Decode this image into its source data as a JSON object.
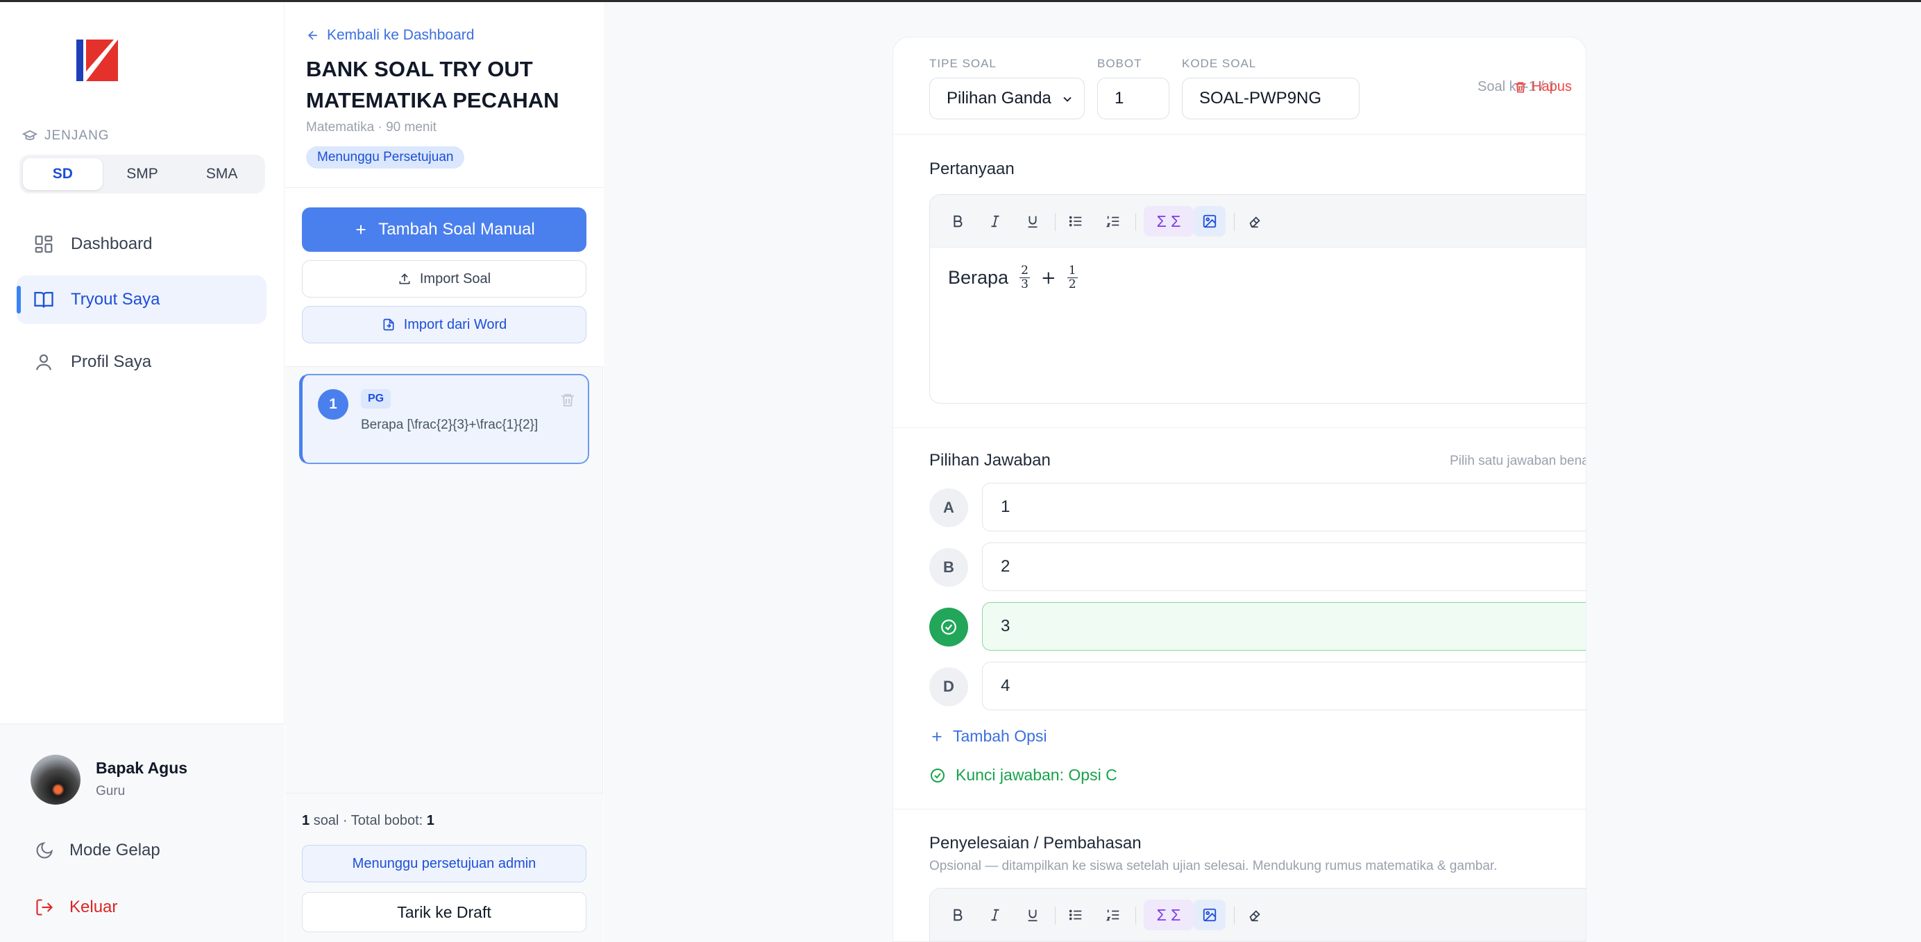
{
  "sidebar": {
    "jenjang_label": "JENJANG",
    "levels": [
      "SD",
      "SMP",
      "SMA"
    ],
    "nav": [
      {
        "label": "Dashboard",
        "icon": "grid-icon"
      },
      {
        "label": "Tryout Saya",
        "icon": "book-icon"
      },
      {
        "label": "Profil Saya",
        "icon": "user-icon"
      }
    ],
    "user": {
      "name": "Bapak Agus",
      "role": "Guru"
    },
    "dark_mode_label": "Mode Gelap",
    "logout_label": "Keluar"
  },
  "panel": {
    "back_label": "Kembali ke Dashboard",
    "title": "BANK SOAL TRY OUT MATEMATIKA PECAHAN",
    "subtitle": "Matematika · 90 menit",
    "status_badge": "Menunggu Persetujuan",
    "add_manual_label": "Tambah Soal Manual",
    "import_label": "Import Soal",
    "import_word_label": "Import dari Word",
    "question_item": {
      "number": "1",
      "tag": "PG",
      "text": "Berapa [\\frac{2}{3}+\\frac{1}{2}]"
    },
    "footer": {
      "count": "1",
      "count_suffix": "soal · Total bobot:",
      "total": "1"
    },
    "waiting_label": "Menunggu persetujuan admin",
    "draft_label": "Tarik ke Draft"
  },
  "editor": {
    "tipe_label": "TIPE SOAL",
    "tipe_value": "Pilihan Ganda",
    "bobot_label": "BOBOT",
    "bobot_value": "1",
    "kode_label": "KODE SOAL",
    "kode_value": "SOAL-PWP9NG",
    "soal_ke": "Soal ke-1 / 1",
    "hapus_label": "Hapus",
    "pertanyaan_label": "Pertanyaan",
    "question_prefix": "Berapa",
    "fraction1": {
      "num": "2",
      "den": "3"
    },
    "operator": "+",
    "fraction2": {
      "num": "1",
      "den": "2"
    },
    "sigma_label": "Σ Σ",
    "pilihan_label": "Pilihan Jawaban",
    "pilihan_hint": "Pilih satu jawaban benar",
    "options": [
      {
        "letter": "A",
        "value": "1"
      },
      {
        "letter": "B",
        "value": "2"
      },
      {
        "letter": "C",
        "value": "3"
      },
      {
        "letter": "D",
        "value": "4"
      }
    ],
    "add_option_label": "Tambah Opsi",
    "kunci_label": "Kunci jawaban: Opsi C",
    "pembahasan_label": "Penyelesaian / Pembahasan",
    "pembahasan_desc": "Opsional — ditampilkan ke siswa setelah ujian selesai. Mendukung rumus matematika & gambar."
  },
  "colors": {
    "accent": "#4a7fee",
    "success": "#22a65a",
    "danger": "#ef4444"
  }
}
